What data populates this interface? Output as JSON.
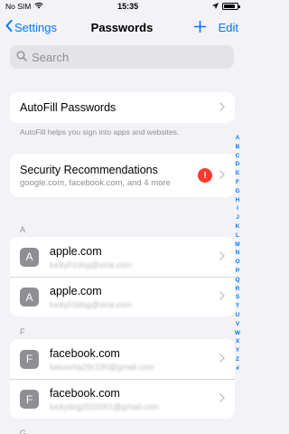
{
  "status": {
    "carrier": "No SIM",
    "time": "15:35"
  },
  "nav": {
    "back_label": "Settings",
    "title": "Passwords",
    "edit_label": "Edit"
  },
  "search": {
    "placeholder": "Search"
  },
  "autofill": {
    "label": "AutoFill Passwords",
    "footnote": "AutoFill helps you sign into apps and websites."
  },
  "security": {
    "title": "Security Recommendations",
    "subtitle": "google.com, facebook.com, and 4 more",
    "badge": "!"
  },
  "sections": [
    {
      "header": "A",
      "items": [
        {
          "letter": "A",
          "domain": "apple.com",
          "user": "lucky01dog@sina.com"
        },
        {
          "letter": "A",
          "domain": "apple.com",
          "user": "lucky03dog@sina.com"
        }
      ]
    },
    {
      "header": "F",
      "items": [
        {
          "letter": "F",
          "domain": "facebook.com",
          "user": "katuscha29c190@gmail.com"
        },
        {
          "letter": "F",
          "domain": "facebook.com",
          "user": "luckydog2022001@gmail.com"
        }
      ]
    },
    {
      "header": "G"
    }
  ],
  "index_letters": [
    "A",
    "B",
    "C",
    "D",
    "E",
    "F",
    "G",
    "H",
    "I",
    "J",
    "K",
    "L",
    "M",
    "N",
    "O",
    "P",
    "Q",
    "R",
    "S",
    "T",
    "U",
    "V",
    "W",
    "X",
    "Y",
    "Z",
    "#"
  ],
  "colors": {
    "accent": "#007aff",
    "alert": "#ff3b30"
  }
}
